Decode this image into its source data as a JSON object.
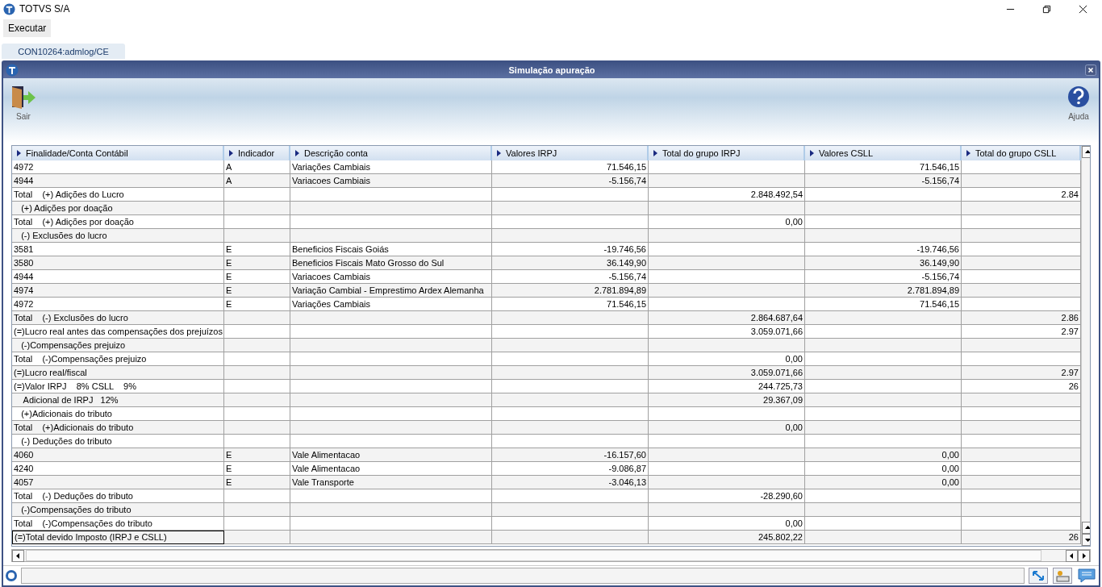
{
  "window": {
    "title": "TOTVS S/A"
  },
  "menu": [
    "Executar"
  ],
  "tab": {
    "label": "CON10264:admlog/CE",
    "selected": true
  },
  "dialog": {
    "title": "Simulação apuração"
  },
  "toolbar": {
    "left": "Sair",
    "right": "Ajuda"
  },
  "table": {
    "columns": [
      "Finalidade/Conta Contábil",
      "Indicador",
      "Descrição conta",
      "Valores IRPJ",
      "Total do grupo IRPJ",
      "Valores CSLL",
      "Total do grupo CSLL"
    ],
    "rows": [
      {
        "selected": false,
        "cells": [
          "4972",
          "A",
          "Variações Cambiais",
          "71.546,15",
          "",
          "71.546,15",
          ""
        ]
      },
      {
        "selected": false,
        "cells": [
          "4944",
          "A",
          "Variacoes Cambiais",
          "-5.156,74",
          "",
          "-5.156,74",
          ""
        ]
      },
      {
        "selected": false,
        "cells": [
          "Total    (+) Adições do Lucro",
          "",
          "",
          "",
          "2.848.492,54",
          "",
          "2.84"
        ]
      },
      {
        "selected": false,
        "cells": [
          "   (+) Adições por doação",
          "",
          "",
          "",
          "",
          "",
          ""
        ]
      },
      {
        "selected": false,
        "cells": [
          "Total    (+) Adições por doação",
          "",
          "",
          "",
          "0,00",
          "",
          ""
        ]
      },
      {
        "selected": false,
        "cells": [
          "   (-) Exclusões do lucro",
          "",
          "",
          "",
          "",
          "",
          ""
        ]
      },
      {
        "selected": false,
        "cells": [
          "3581",
          "E",
          "Beneficios Fiscais Goiás",
          "-19.746,56",
          "",
          "-19.746,56",
          ""
        ]
      },
      {
        "selected": false,
        "cells": [
          "3580",
          "E",
          "Beneficios Fiscais Mato Grosso do Sul",
          "36.149,90",
          "",
          "36.149,90",
          ""
        ]
      },
      {
        "selected": false,
        "cells": [
          "4944",
          "E",
          "Variacoes Cambiais",
          "-5.156,74",
          "",
          "-5.156,74",
          ""
        ]
      },
      {
        "selected": false,
        "cells": [
          "4974",
          "E",
          "Variação Cambial - Emprestimo Ardex Alemanha",
          "2.781.894,89",
          "",
          "2.781.894,89",
          ""
        ]
      },
      {
        "selected": false,
        "cells": [
          "4972",
          "E",
          "Variações Cambiais",
          "71.546,15",
          "",
          "71.546,15",
          ""
        ]
      },
      {
        "selected": false,
        "cells": [
          "Total    (-) Exclusões do lucro",
          "",
          "",
          "",
          "2.864.687,64",
          "",
          "2.86"
        ]
      },
      {
        "selected": false,
        "cells": [
          "(=)Lucro real antes das compensações dos prejuízos",
          "",
          "",
          "",
          "3.059.071,66",
          "",
          "2.97"
        ]
      },
      {
        "selected": false,
        "cells": [
          "   (-)Compensações prejuizo",
          "",
          "",
          "",
          "",
          "",
          ""
        ]
      },
      {
        "selected": false,
        "cells": [
          "Total    (-)Compensações prejuizo",
          "",
          "",
          "",
          "0,00",
          "",
          ""
        ]
      },
      {
        "selected": false,
        "cells": [
          "(=)Lucro real/fiscal",
          "",
          "",
          "",
          "3.059.071,66",
          "",
          "2.97"
        ]
      },
      {
        "selected": false,
        "cells": [
          "(=)Valor IRPJ    8% CSLL    9%",
          "",
          "",
          "",
          "244.725,73",
          "",
          "26"
        ]
      },
      {
        "selected": false,
        "cells": [
          "    Adicional de IRPJ   12%",
          "",
          "",
          "",
          "29.367,09",
          "",
          ""
        ]
      },
      {
        "selected": false,
        "cells": [
          "   (+)Adicionais do tributo",
          "",
          "",
          "",
          "",
          "",
          ""
        ]
      },
      {
        "selected": false,
        "cells": [
          "Total    (+)Adicionais do tributo",
          "",
          "",
          "",
          "0,00",
          "",
          ""
        ]
      },
      {
        "selected": false,
        "cells": [
          "   (-) Deduções do tributo",
          "",
          "",
          "",
          "",
          "",
          ""
        ]
      },
      {
        "selected": false,
        "cells": [
          "4060",
          "E",
          "Vale Alimentacao",
          "-16.157,60",
          "",
          "0,00",
          ""
        ]
      },
      {
        "selected": false,
        "cells": [
          "4240",
          "E",
          "Vale Alimentacao",
          "-9.086,87",
          "",
          "0,00",
          ""
        ]
      },
      {
        "selected": false,
        "cells": [
          "4057",
          "E",
          "Vale Transporte",
          "-3.046,13",
          "",
          "0,00",
          ""
        ]
      },
      {
        "selected": false,
        "cells": [
          "Total    (-) Deduções do tributo",
          "",
          "",
          "",
          "-28.290,60",
          "",
          ""
        ]
      },
      {
        "selected": false,
        "cells": [
          "   (-)Compensações do tributo",
          "",
          "",
          "",
          "",
          "",
          ""
        ]
      },
      {
        "selected": false,
        "cells": [
          "Total    (-)Compensações do tributo",
          "",
          "",
          "",
          "0,00",
          "",
          ""
        ]
      },
      {
        "selected": true,
        "cells": [
          "(=)Total devido Imposto (IRPJ e CSLL)",
          "",
          "",
          "",
          "245.802,22",
          "",
          "26"
        ]
      }
    ]
  }
}
